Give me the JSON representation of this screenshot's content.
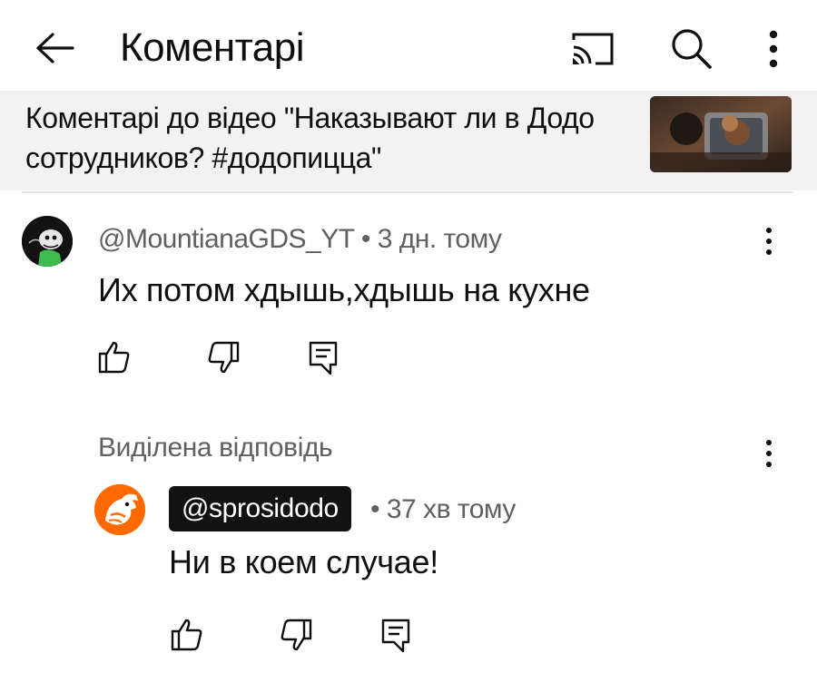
{
  "header": {
    "title": "Коментарі",
    "icons": [
      "back-arrow-icon",
      "cast-icon",
      "search-icon",
      "more-vert-icon"
    ]
  },
  "video_banner": {
    "text": "Коментарі до відео \"Наказывают ли в Додо сотрудников? #додопицца\""
  },
  "comment": {
    "author": "@MountianaGDS_YT",
    "separator": "•",
    "time": "3 дн. тому",
    "text": "Их потом хдышь,хдышь на кухне",
    "actions": [
      "like-icon",
      "dislike-icon",
      "reply-icon"
    ]
  },
  "highlighted_reply": {
    "label": "Виділена відповідь",
    "author": "@sprosidodo",
    "separator": "•",
    "time": "37 хв тому",
    "text": "Ни в коем случае!",
    "actions": [
      "like-icon",
      "dislike-icon",
      "reply-icon"
    ]
  },
  "colors": {
    "background": "#ffffff",
    "banner_background": "#f2f2f2",
    "secondary_text": "#606060",
    "author_chip": "#121212",
    "dodo_orange": "#ff6900"
  }
}
